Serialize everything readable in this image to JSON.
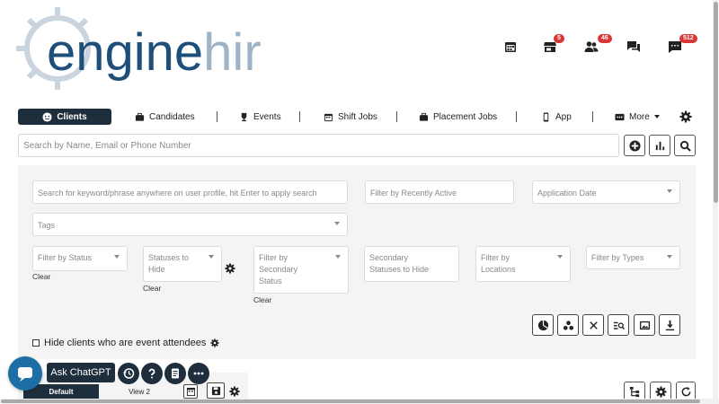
{
  "logo": {
    "part1": "engine",
    "part2": "hire"
  },
  "top_icons": [
    {
      "icon": "calendar-icon",
      "badge": ""
    },
    {
      "icon": "store-icon",
      "badge": "5"
    },
    {
      "icon": "users-icon",
      "badge": "46"
    },
    {
      "icon": "chat-icon",
      "badge": ""
    },
    {
      "icon": "message-icon",
      "badge": "512"
    }
  ],
  "tabs": {
    "clients": "Clients",
    "candidates": "Candidates",
    "events": "Events",
    "shift_jobs": "Shift Jobs",
    "placement_jobs": "Placement Jobs",
    "app": "App",
    "more": "More"
  },
  "search": {
    "placeholder": "Search by Name, Email or Phone Number"
  },
  "filters": {
    "keyword": "Search for keyword/phrase anywhere on user profile, hit Enter to apply search",
    "recently_active": "Filter by Recently Active",
    "application_date": "Application Date",
    "tags": "Tags",
    "status": "Filter by Status",
    "statuses_to_hide": "Statuses to Hide",
    "secondary_status": "Filter by Secondary Status",
    "secondary_statuses_to_hide": "Secondary Statuses to Hide",
    "locations": "Filter by Locations",
    "types": "Filter by Types",
    "clear": "Clear"
  },
  "hide_clients_label": "Hide clients who are event attendees",
  "views": {
    "default": "Default",
    "view2": "View 2"
  },
  "chat": {
    "ask_label": "Ask ChatGPT"
  },
  "colors": {
    "brand_dark": "#1f2e3d",
    "badge_red": "#d93636",
    "logo_blue": "#1e4f7a",
    "logo_light": "#c9d4de"
  }
}
